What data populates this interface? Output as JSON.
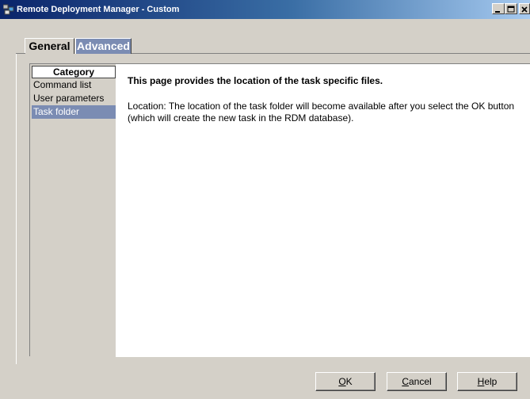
{
  "window": {
    "title": "Remote Deployment Manager - Custom",
    "titlebar_color": "#0a246a",
    "selection_color": "#7b8cb3"
  },
  "tabs": [
    {
      "label": "General",
      "selected": true
    },
    {
      "label": "Advanced",
      "selected": false
    }
  ],
  "category": {
    "header": "Category",
    "items": [
      {
        "label": "Command list",
        "selected": false
      },
      {
        "label": "User parameters",
        "selected": false
      },
      {
        "label": "Task folder",
        "selected": true
      }
    ]
  },
  "content": {
    "heading": "This page provides the location of the task specific files.",
    "description": "Location:  The location of the task folder will become available after you select the OK button (which will create the new task in the RDM database)."
  },
  "buttons": {
    "ok": {
      "mnemonic": "O",
      "rest": "K"
    },
    "cancel": {
      "mnemonic": "C",
      "rest": "ancel"
    },
    "help": {
      "mnemonic": "H",
      "rest": "elp"
    }
  }
}
